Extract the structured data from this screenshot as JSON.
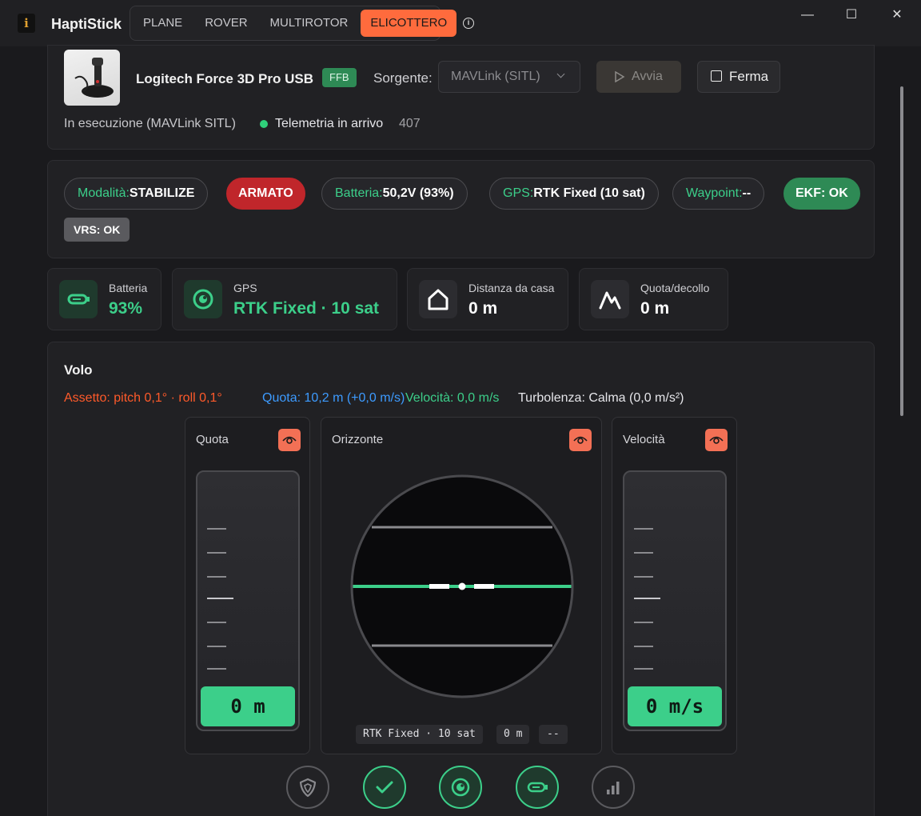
{
  "app": {
    "title": "HaptiStick",
    "icon_glyph": "i"
  },
  "tabs": [
    {
      "label": "PLANE",
      "active": false
    },
    {
      "label": "ROVER",
      "active": false
    },
    {
      "label": "MULTIROTOR",
      "active": false
    },
    {
      "label": "ELICOTTERO",
      "active": true
    }
  ],
  "window": {
    "minimize": "—",
    "maximize": "☐",
    "close": "✕"
  },
  "device": {
    "name": "Logitech Force 3D Pro USB",
    "badge": "FFB",
    "source_label": "Sorgente:",
    "source_value": "MAVLink (SITL)",
    "start_label": "Avvia",
    "stop_label": "Ferma",
    "status": "In esecuzione (MAVLink SITL)",
    "telemetry_label": "Telemetria in arrivo",
    "telemetry_count": "407"
  },
  "status_pills": {
    "mode_key": "Modalità:",
    "mode_val": "STABILIZE",
    "armed": "ARMATO",
    "battery_key": "Batteria:",
    "battery_val": "50,2V (93%)",
    "gps_key": "GPS:",
    "gps_val": "RTK Fixed (10 sat)",
    "waypoint_key": "Waypoint:",
    "waypoint_val": "--",
    "ekf": "EKF: OK",
    "vrs": "VRS: OK"
  },
  "stats": {
    "battery_label": "Batteria",
    "battery_value": "93%",
    "gps_label": "GPS",
    "gps_value": "RTK Fixed · 10 sat",
    "home_label": "Distanza da casa",
    "home_value": "0 m",
    "alt_label": "Quota/decollo",
    "alt_value": "0 m"
  },
  "flight": {
    "title": "Volo",
    "attitude": "Assetto: pitch 0,1° · roll 0,1°",
    "altitude": "Quota: 10,2 m (+0,0 m/s)",
    "speed": "Velocità: 0,0 m/s",
    "turbulence": "Turbolenza: Calma (0,0 m/s²)",
    "quota_title": "Quota",
    "quota_value": "0 m",
    "horizon_title": "Orizzonte",
    "speed_title": "Velocità",
    "speed_value": "0 m/s",
    "chip_gps": "RTK Fixed · 10 sat",
    "chip_dist": "0 m",
    "chip_wp": "--"
  },
  "colors": {
    "accent": "#ff6b3d",
    "green": "#3ccf8a",
    "red": "#c0262b",
    "orange_text": "#ff5a2a",
    "blue_text": "#3d9bff",
    "eye_button": "#f37055"
  },
  "icons": [
    "info-icon",
    "chevron-down-icon",
    "play-icon",
    "stop-icon",
    "battery-icon",
    "gps-icon",
    "home-icon",
    "mountain-icon",
    "eye-icon",
    "shield-icon",
    "check-icon",
    "signal-icon"
  ]
}
